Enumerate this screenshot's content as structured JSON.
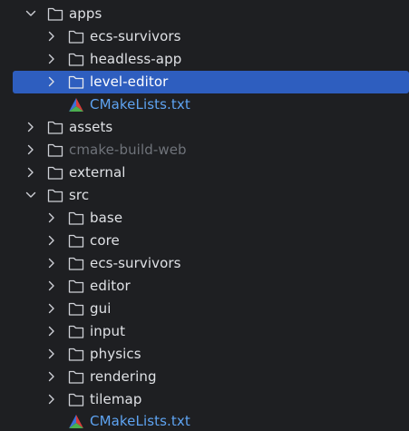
{
  "tree": {
    "colors": {
      "background": "#1e1f22",
      "text": "#dfe1e5",
      "excluded_text": "#6f737a",
      "cmake_file_text": "#5ea3f1",
      "selection": "#2e5ebf"
    },
    "rows": [
      {
        "label": "apps",
        "kind": "folder",
        "expanded": true,
        "icon": "folder-icon"
      },
      {
        "label": "ecs-survivors",
        "kind": "folder",
        "expanded": false,
        "icon": "folder-icon"
      },
      {
        "label": "headless-app",
        "kind": "folder",
        "expanded": false,
        "icon": "folder-icon"
      },
      {
        "label": "level-editor",
        "kind": "folder",
        "expanded": false,
        "selected": true,
        "icon": "folder-icon"
      },
      {
        "label": "CMakeLists.txt",
        "kind": "file",
        "icon": "cmake-icon"
      },
      {
        "label": "assets",
        "kind": "folder",
        "expanded": false,
        "icon": "folder-icon"
      },
      {
        "label": "cmake-build-web",
        "kind": "folder",
        "expanded": false,
        "excluded": true,
        "icon": "folder-icon"
      },
      {
        "label": "external",
        "kind": "folder",
        "expanded": false,
        "icon": "folder-icon"
      },
      {
        "label": "src",
        "kind": "folder",
        "expanded": true,
        "icon": "folder-icon"
      },
      {
        "label": "base",
        "kind": "folder",
        "expanded": false,
        "icon": "folder-icon"
      },
      {
        "label": "core",
        "kind": "folder",
        "expanded": false,
        "icon": "folder-icon"
      },
      {
        "label": "ecs-survivors",
        "kind": "folder",
        "expanded": false,
        "icon": "folder-icon"
      },
      {
        "label": "editor",
        "kind": "folder",
        "expanded": false,
        "icon": "folder-icon"
      },
      {
        "label": "gui",
        "kind": "folder",
        "expanded": false,
        "icon": "folder-icon"
      },
      {
        "label": "input",
        "kind": "folder",
        "expanded": false,
        "icon": "folder-icon"
      },
      {
        "label": "physics",
        "kind": "folder",
        "expanded": false,
        "icon": "folder-icon"
      },
      {
        "label": "rendering",
        "kind": "folder",
        "expanded": false,
        "icon": "folder-icon"
      },
      {
        "label": "tilemap",
        "kind": "folder",
        "expanded": false,
        "icon": "folder-icon"
      },
      {
        "label": "CMakeLists.txt",
        "kind": "file",
        "icon": "cmake-icon"
      }
    ]
  }
}
